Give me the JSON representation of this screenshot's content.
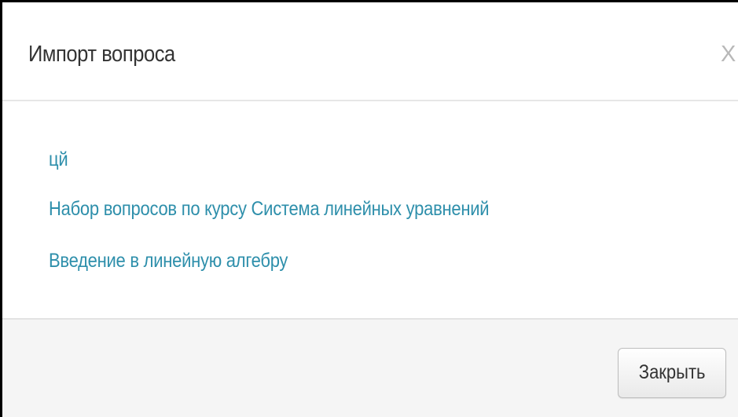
{
  "dialog": {
    "title": "Импорт вопроса",
    "close_icon_label": "X",
    "close_button_label": "Закрыть"
  },
  "items": [
    {
      "label": "цй"
    },
    {
      "label": "Набор вопросов по курсу Система линейных уравнений"
    },
    {
      "label": "Введение в линейную алгебру"
    }
  ],
  "colors": {
    "link": "#2e8fab",
    "title": "#333333",
    "footer_bg": "#f5f5f5"
  }
}
